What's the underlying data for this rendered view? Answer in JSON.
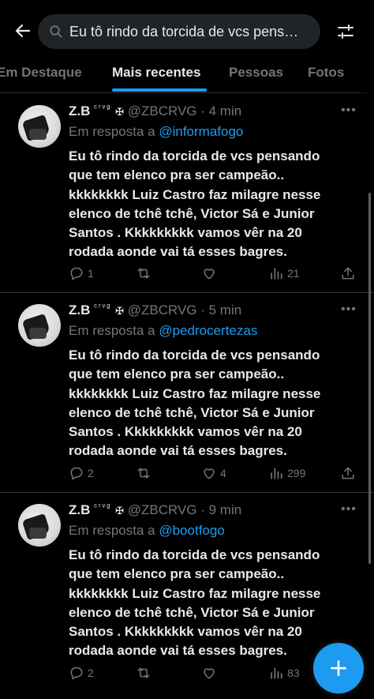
{
  "search": {
    "query": "Eu tô rindo da torcida de vcs pensando",
    "back_icon": "arrow-left-icon",
    "filter_icon": "sliders-icon"
  },
  "tabs": [
    {
      "label": "Em Destaque"
    },
    {
      "label": "Mais recentes"
    },
    {
      "label": "Pessoas"
    },
    {
      "label": "Fotos"
    }
  ],
  "accent_color": "#1d9bf0",
  "tweets": [
    {
      "name": "Z.B",
      "name_deco": "ᶜʳᵛᵍ",
      "cross": "✠",
      "handle": "@ZBCRVG",
      "time": "4 min",
      "reply_prefix": "Em resposta a",
      "reply_to": "@informafogo",
      "lines": [
        "Eu tô rindo da torcida de vcs pensando",
        "que tem elenco pra ser campeão..",
        "kkkkkkkk Luiz Castro faz milagre nesse",
        "elenco de tchê tchê, Victor Sá e Junior",
        "Santos . Kkkkkkkkk vamos vêr na 20",
        "rodada aonde vai tá esses bagres."
      ],
      "replies": "1",
      "retweets": "",
      "likes": "",
      "views": "21"
    },
    {
      "name": "Z.B",
      "name_deco": "ᶜʳᵛᵍ",
      "cross": "✠",
      "handle": "@ZBCRVG",
      "time": "5 min",
      "reply_prefix": "Em resposta a",
      "reply_to": "@pedrocertezas",
      "lines": [
        "Eu tô rindo da torcida de vcs pensando",
        "que tem elenco pra ser campeão..",
        "kkkkkkkk Luiz Castro faz milagre nesse",
        "elenco de tchê tchê, Victor Sá e Junior",
        "Santos . Kkkkkkkkk vamos vêr na 20",
        "rodada aonde vai tá esses bagres."
      ],
      "replies": "2",
      "retweets": "",
      "likes": "4",
      "views": "299"
    },
    {
      "name": "Z.B",
      "name_deco": "ᶜʳᵛᵍ",
      "cross": "✠",
      "handle": "@ZBCRVG",
      "time": "9 min",
      "reply_prefix": "Em resposta a",
      "reply_to": "@bootfogo",
      "lines": [
        "Eu tô rindo da torcida de vcs pensando",
        "que tem elenco pra ser campeão..",
        "kkkkkkkk Luiz Castro faz milagre nesse",
        "elenco de tchê tchê, Victor Sá e Junior",
        "Santos . Kkkkkkkkk vamos vêr na 20",
        "rodada aonde vai tá esses bagres."
      ],
      "replies": "2",
      "retweets": "",
      "likes": "",
      "views": "83"
    }
  ],
  "fab_icon": "plus-icon"
}
